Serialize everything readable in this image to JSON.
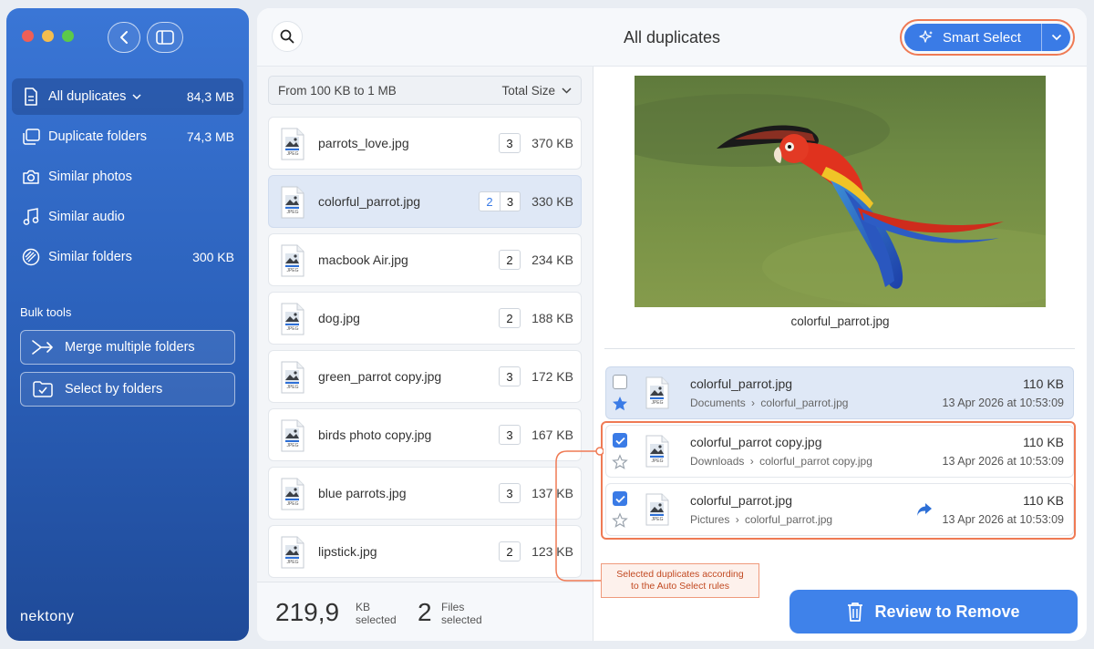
{
  "sidebar": {
    "items": [
      {
        "label": "All duplicates",
        "size": "84,3 MB"
      },
      {
        "label": "Duplicate folders",
        "size": "74,3 MB"
      },
      {
        "label": "Similar photos",
        "size": ""
      },
      {
        "label": "Similar audio",
        "size": ""
      },
      {
        "label": "Similar folders",
        "size": "300 KB"
      }
    ],
    "bulk_title": "Bulk tools",
    "bulk_tools": [
      {
        "label": "Merge multiple folders"
      },
      {
        "label": "Select by folders"
      }
    ],
    "logo": "nektony"
  },
  "header": {
    "title": "All duplicates",
    "smart_select_label": "Smart Select"
  },
  "filter": {
    "range_label": "From 100 KB to 1 MB",
    "sort_label": "Total Size"
  },
  "files": [
    {
      "name": "parrots_love.jpg",
      "count": "3",
      "size": "370 KB"
    },
    {
      "name": "colorful_parrot.jpg",
      "selected_count": "2",
      "count": "3",
      "size": "330 KB"
    },
    {
      "name": "macbook Air.jpg",
      "count": "2",
      "size": "234 KB"
    },
    {
      "name": "dog.jpg",
      "count": "2",
      "size": "188 KB"
    },
    {
      "name": "green_parrot copy.jpg",
      "count": "3",
      "size": "172 KB"
    },
    {
      "name": "birds photo copy.jpg",
      "count": "3",
      "size": "167 KB"
    },
    {
      "name": "blue parrots.jpg",
      "count": "3",
      "size": "137 KB"
    },
    {
      "name": "lipstick.jpg",
      "count": "2",
      "size": "123 KB"
    }
  ],
  "file_icon_label": "JPEG",
  "status": {
    "size_value": "219,9",
    "size_unit": "KB",
    "size_caption": "selected",
    "files_value": "2",
    "files_unit": "Files",
    "files_caption": "selected"
  },
  "preview": {
    "name": "colorful_parrot.jpg"
  },
  "duplicates": [
    {
      "name": "colorful_parrot.jpg",
      "folder": "Documents",
      "path_file": "colorful_parrot.jpg",
      "size": "110 KB",
      "date": "13 Apr 2026 at 10:53:09",
      "checked": false,
      "starred": true
    },
    {
      "name": "colorful_parrot copy.jpg",
      "folder": "Downloads",
      "path_file": "colorful_parrot copy.jpg",
      "size": "110 KB",
      "date": "13 Apr 2026 at 10:53:09",
      "checked": true,
      "starred": false
    },
    {
      "name": "colorful_parrot.jpg",
      "folder": "Pictures",
      "path_file": "colorful_parrot.jpg",
      "size": "110 KB",
      "date": "13 Apr 2026 at 10:53:09",
      "checked": true,
      "starred": false
    }
  ],
  "path_separator": "›",
  "callout": {
    "line1": "Selected duplicates according",
    "line2": "to the Auto Select rules"
  },
  "review_button_label": "Review to Remove",
  "colors": {
    "accent": "#3a7be6",
    "highlight": "#ef7a54",
    "sidebar_top": "#3a76d6",
    "sidebar_bottom": "#1f4a98"
  }
}
